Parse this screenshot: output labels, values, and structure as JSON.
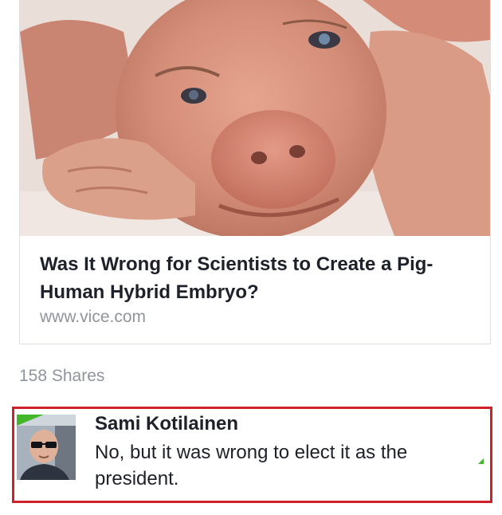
{
  "link_preview": {
    "image": "pig-human-hybrid-photo",
    "title": "Was It Wrong for Scientists to Create a Pig-Human Hybrid Embryo?",
    "domain": "www.vice.com"
  },
  "post_stats": {
    "shares": "158 Shares"
  },
  "comment": {
    "author": "Sami Kotilainen",
    "text": "No, but it was wrong to elect it as the president.",
    "avatar": "user-avatar-photo"
  },
  "colors": {
    "highlight_border": "#d0202a",
    "text_primary": "#1d2129",
    "text_secondary": "#90949c",
    "accent_green": "#42b72a"
  }
}
